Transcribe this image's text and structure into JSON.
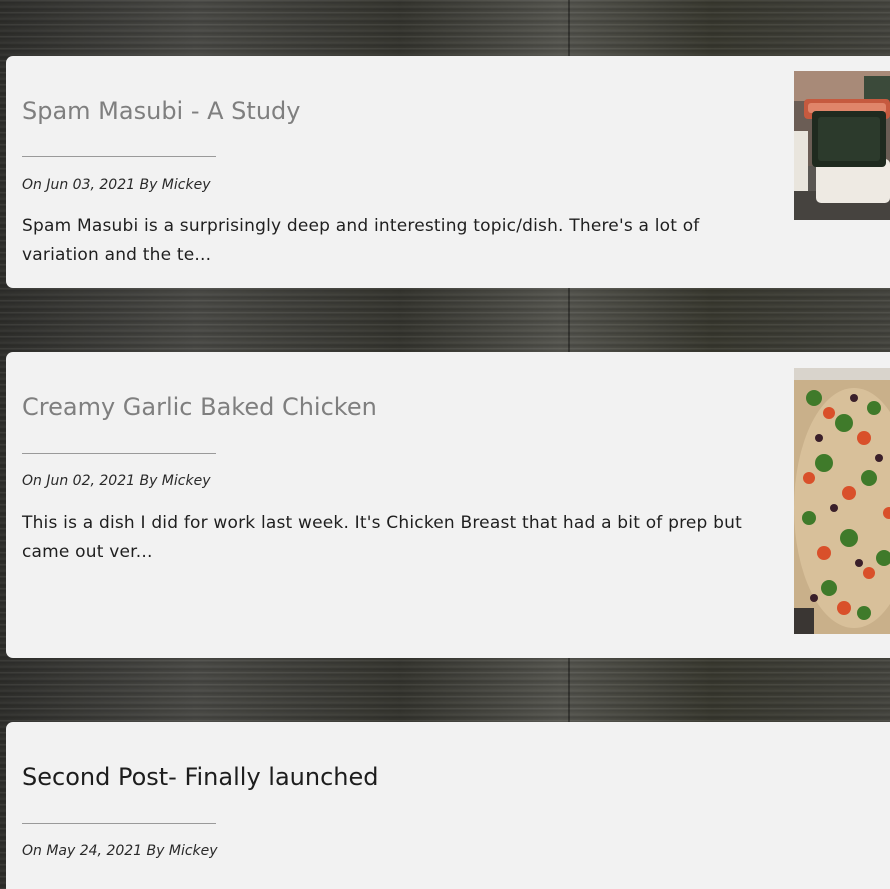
{
  "posts": [
    {
      "title": "Spam Masubi - A Study",
      "meta": "On Jun 03, 2021 By Mickey",
      "excerpt": "Spam Masubi is a surprisingly deep and interesting topic/dish. There's a lot of variation and the te...",
      "thumbnail": "spam-musubi-photo"
    },
    {
      "title": "Creamy Garlic Baked Chicken",
      "meta": "On Jun 02, 2021 By Mickey",
      "excerpt": "This is a dish I did for work last week. It's Chicken Breast that had a bit of prep but came out ver...",
      "thumbnail": "baked-chicken-photo"
    },
    {
      "title": "Second Post- Finally launched",
      "meta": "On May 24, 2021 By Mickey",
      "excerpt": ""
    }
  ],
  "colors": {
    "card_background": "#f2f2f2",
    "title_link": "#7f7f7f",
    "title_active": "#1d1d1d",
    "text": "#1f1f1f"
  }
}
